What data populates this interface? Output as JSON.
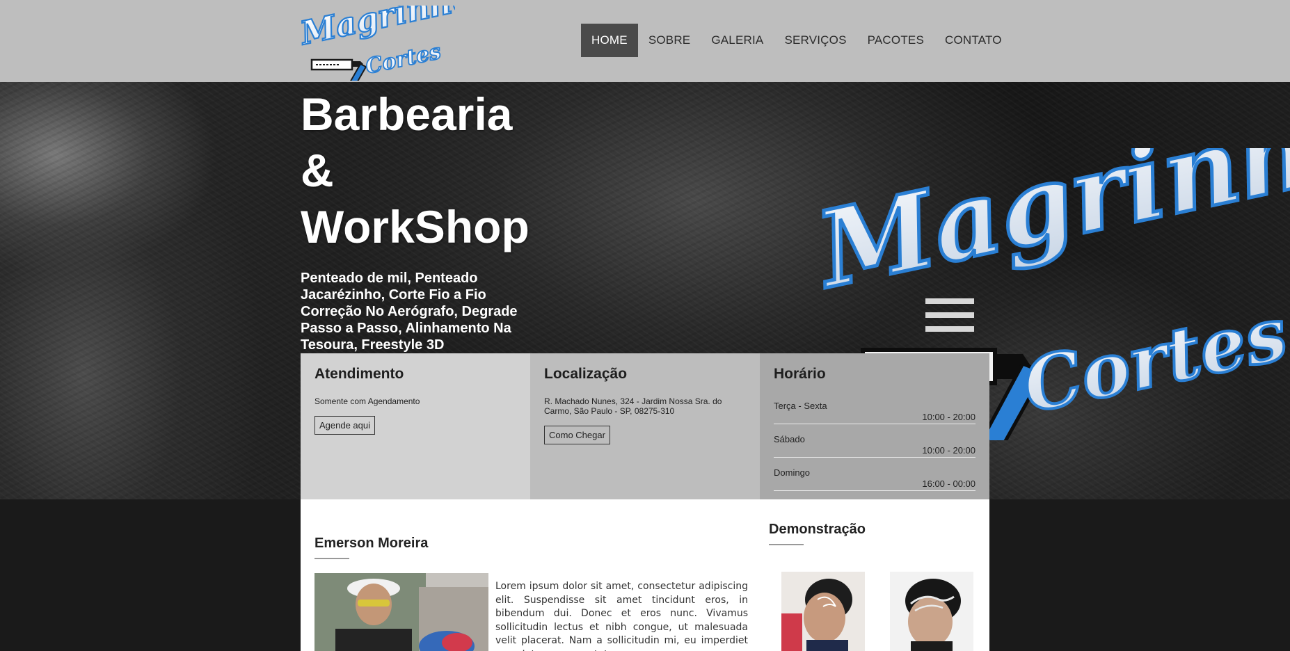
{
  "header": {
    "logo_text": [
      "Magrinho",
      "Cortes"
    ],
    "nav": [
      {
        "label": "HOME",
        "active": true
      },
      {
        "label": "SOBRE",
        "active": false
      },
      {
        "label": "GALERIA",
        "active": false
      },
      {
        "label": "SERVIÇOS",
        "active": false
      },
      {
        "label": "PACOTES",
        "active": false
      },
      {
        "label": "CONTATO",
        "active": false
      }
    ]
  },
  "hero": {
    "title_lines": [
      "Barbearia",
      "&",
      "WorkShop"
    ],
    "subtitle": "Penteado de mil, Penteado Jacarézinho, Corte Fio a Fio Correção No Aerógrafo, Degrade Passo a Passo, Alinhamento Na Tesoura, Freestyle 3D",
    "watermark_text": [
      "Magrinho",
      "Cortes"
    ]
  },
  "info": {
    "atendimento": {
      "title": "Atendimento",
      "text": "Somente com Agendamento",
      "button": "Agende aqui"
    },
    "localizacao": {
      "title": "Localização",
      "text": "R. Machado Nunes, 324 - Jardim Nossa Sra. do Carmo, São Paulo - SP, 08275-310",
      "button": "Como Chegar"
    },
    "horario": {
      "title": "Horário",
      "rows": [
        {
          "day": "Terça - Sexta",
          "time": "10:00 - 20:00"
        },
        {
          "day": "Sábado",
          "time": "10:00 - 20:00"
        },
        {
          "day": "Domingo",
          "time": "16:00 - 00:00"
        }
      ]
    }
  },
  "content": {
    "author_name": "Emerson Moreira",
    "author_text": "Lorem ipsum dolor sit amet, consectetur adipiscing elit. Suspendisse sit amet tincidunt eros, in bibendum dui. Donec et eros nunc. Vivamus sollicitudin lectus et nibh congue, ut malesuada velit placerat. Nam a sollicitudin mi, eu imperdiet sem. Integer consectetur,",
    "demo_title": "Demonstração"
  },
  "colors": {
    "header_bg": "#bebebe",
    "nav_active_bg": "#4a4a4a",
    "logo_blue": "#2a7fd4",
    "page_bg": "#1a1a1a"
  }
}
